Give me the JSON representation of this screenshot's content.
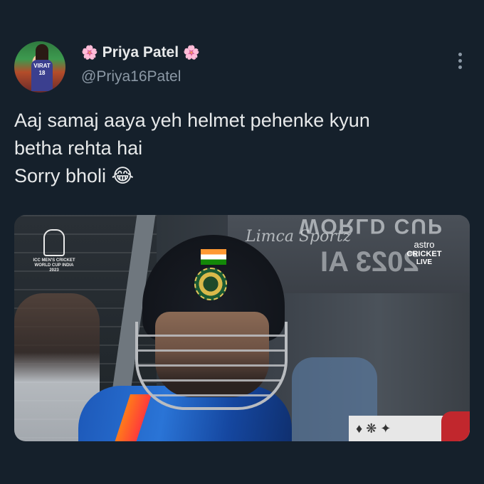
{
  "tweet": {
    "display_name": "Priya Patel",
    "name_prefix_emoji": "🌸",
    "name_suffix_emoji": "🌸",
    "handle": "@Priya16Patel",
    "avatar_jersey_text": "VIRAT 18",
    "text_lines": [
      "Aaj samaj aaya yeh helmet pehenke kyun",
      "betha rehta hai",
      "Sorry bholi 😂"
    ],
    "more_icon": "more-vertical-icon"
  },
  "media": {
    "cwc_logo_text": "ICC MEN'S CRICKET WORLD CUP INDIA 2023",
    "broadcaster_line1": "astro",
    "broadcaster_line2": "CRICKET",
    "broadcaster_line3": "LIVE",
    "background_sign1": "WORLD CUP",
    "background_sign2": "Limca Sportz",
    "background_sign3": "2023 AI",
    "floral_strip": "♦ ❋ ✦"
  },
  "colors": {
    "background": "#15202b",
    "primary_text": "#e7e9ea",
    "secondary_text": "#8b98a5"
  }
}
